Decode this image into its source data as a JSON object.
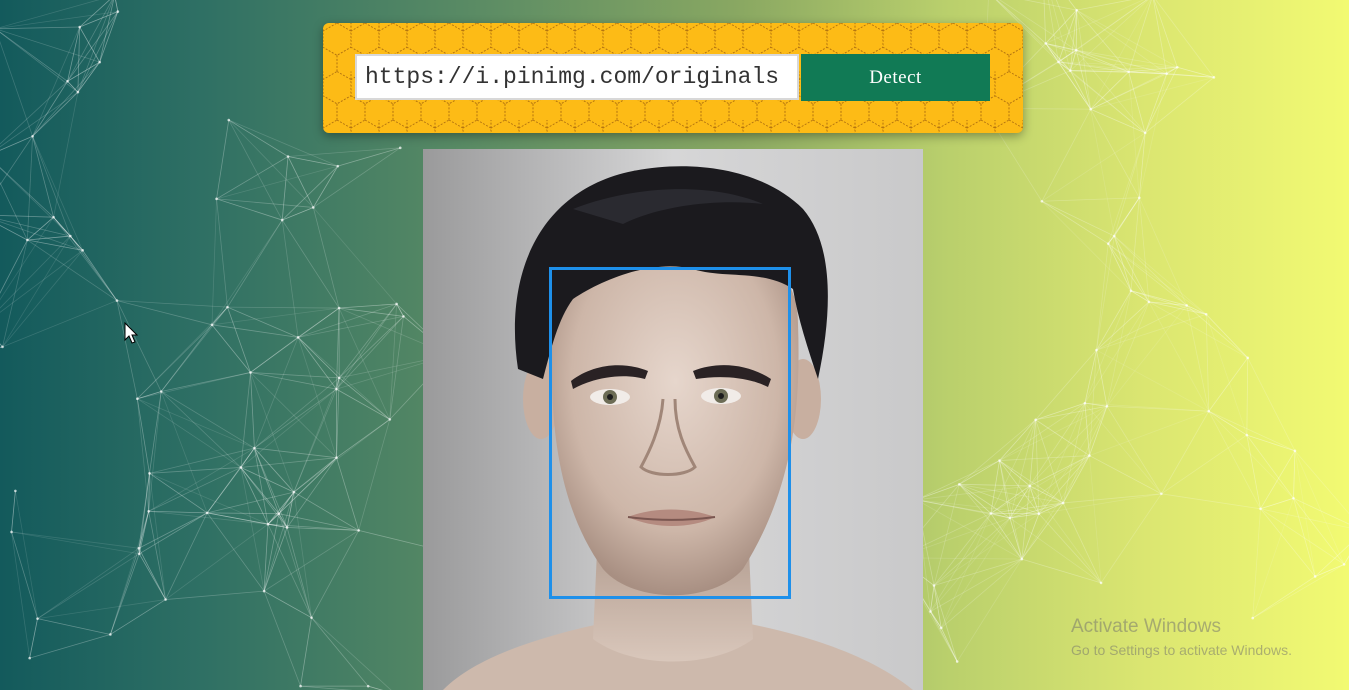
{
  "search": {
    "url_value": "https://i.pinimg.com/originals",
    "detect_label": "Detect"
  },
  "detection": {
    "box_color": "#1e90ea",
    "faces_shown": 1
  },
  "colors": {
    "panel": "#fdbb16",
    "button": "#117a55",
    "gradient_start": "#135a5c",
    "gradient_end": "#f2fa72"
  },
  "watermark": {
    "title": "Activate Windows",
    "subtitle": "Go to Settings to activate Windows."
  },
  "icons": {
    "cursor": "mouse-pointer-icon"
  }
}
